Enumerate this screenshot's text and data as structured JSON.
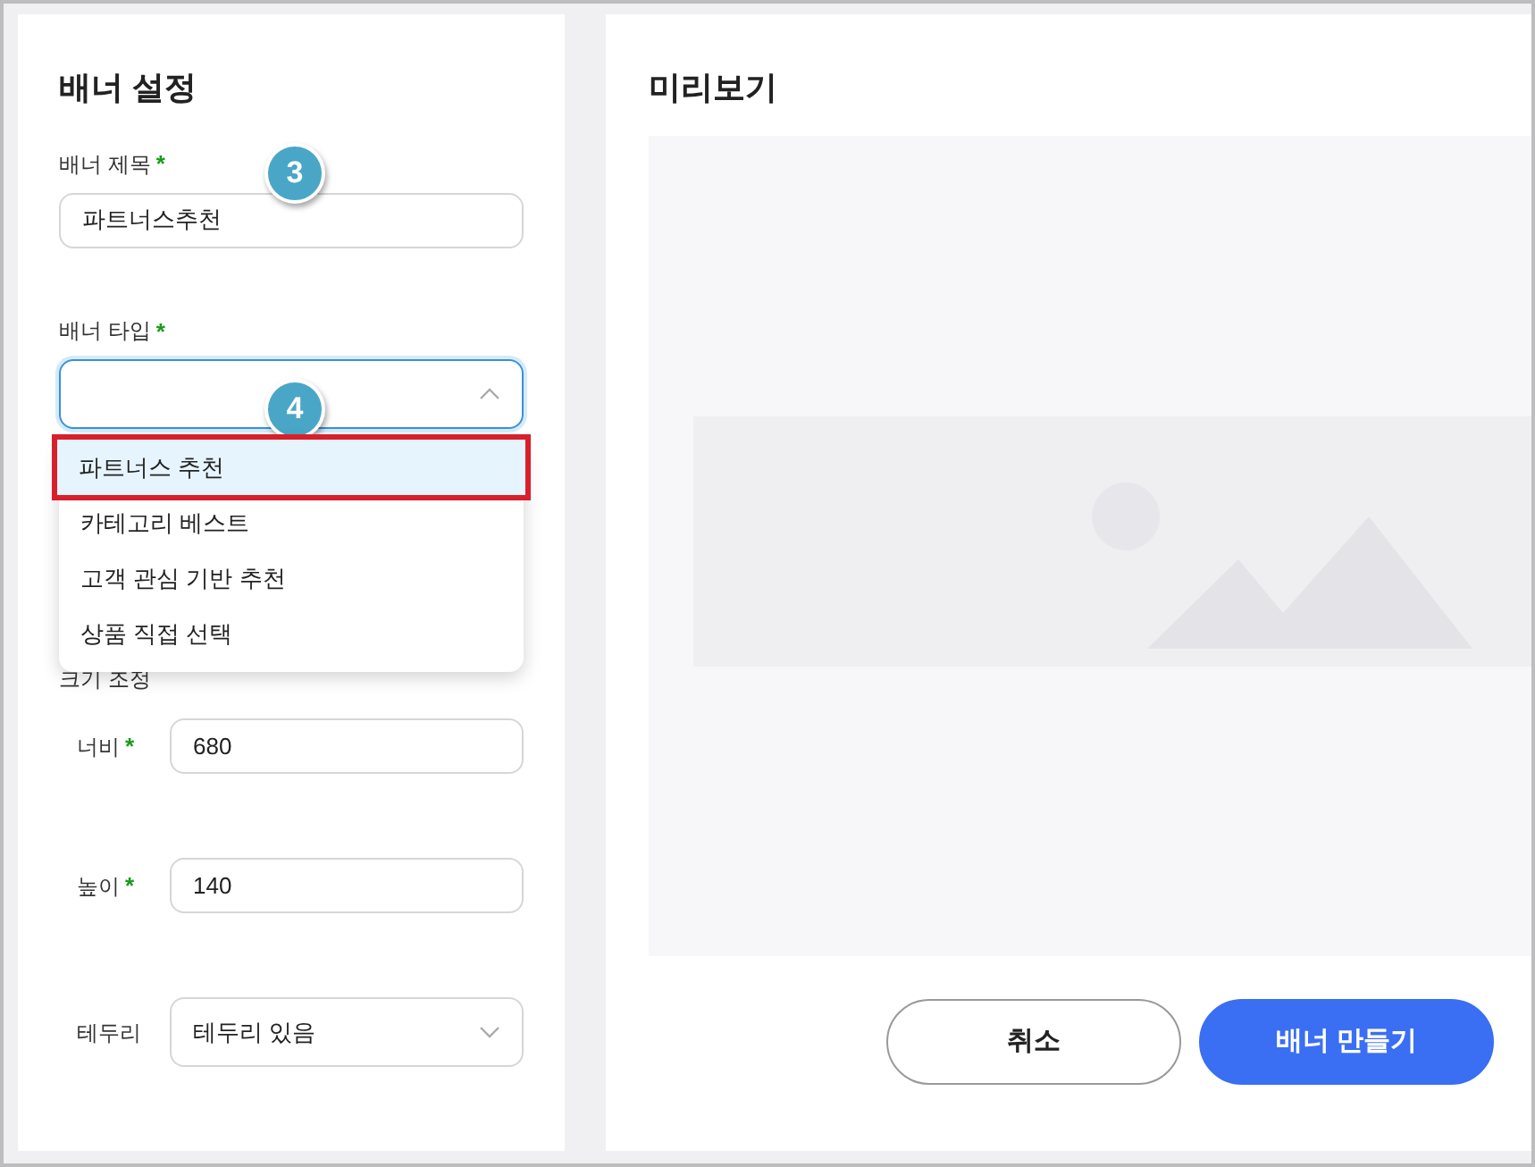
{
  "settings": {
    "title": "배너 설정",
    "title_field": {
      "label": "배너 제목",
      "required_mark": "*",
      "value": "파트너스추천",
      "badge": "3"
    },
    "type_field": {
      "label": "배너 타입",
      "required_mark": "*",
      "badge": "4",
      "expanded": true,
      "options": [
        {
          "label": "파트너스 추천",
          "selected": true,
          "outlined": true
        },
        {
          "label": "카테고리 베스트",
          "selected": false,
          "outlined": false
        },
        {
          "label": "고객 관심 기반 추천",
          "selected": false,
          "outlined": false
        },
        {
          "label": "상품 직접 선택",
          "selected": false,
          "outlined": false
        }
      ]
    },
    "size_section": "크기 조정",
    "size_fields": [
      {
        "kind": "input",
        "label": "너비",
        "required_mark": "*",
        "value": "680"
      },
      {
        "kind": "input",
        "label": "높이",
        "required_mark": "*",
        "value": "140"
      },
      {
        "kind": "select",
        "label": "테두리",
        "value": "테두리 있음"
      }
    ]
  },
  "preview": {
    "title": "미리보기"
  },
  "buttons": [
    {
      "kind": "secondary",
      "label": "취소"
    },
    {
      "kind": "primary",
      "label": "배너 만들기"
    }
  ]
}
